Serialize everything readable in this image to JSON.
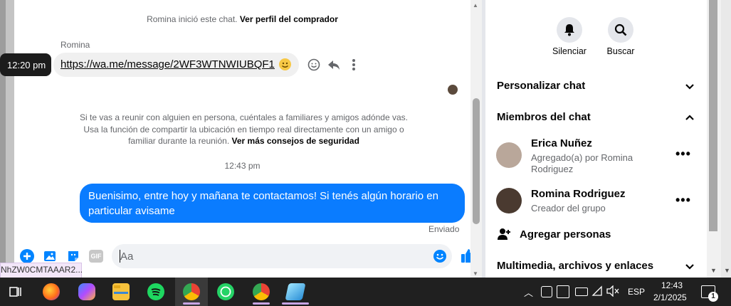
{
  "chat": {
    "system_started": "Romina inició este chat.",
    "system_link": "Ver perfil del comprador",
    "sender_name": "Romina",
    "time_tooltip": "12:20 pm",
    "incoming_message": "https://wa.me/message/2WF3WTNWIUBQF1",
    "safety_text": "Si te vas a reunir con alguien en persona, cuéntales a familiares y amigos adónde vas. Usa la función de compartir la ubicación en tiempo real directamente con un amigo o familiar durante la reunión.",
    "safety_link": "Ver más consejos de seguridad",
    "timestamp": "12:43 pm",
    "outgoing_message": "Buenisimo, entre hoy y mañana te contactamos! Si tenés algún horario en particular avisame",
    "status": "Enviado",
    "composer_placeholder": "Aa",
    "url_tooltip": "NhZW0CMTAAAR2..."
  },
  "panel": {
    "mute_label": "Silenciar",
    "search_label": "Buscar",
    "customize_label": "Personalizar chat",
    "members_label": "Miembros del chat",
    "members": [
      {
        "name": "Erica Nuñez",
        "sub": "Agregado(a) por Romina Rodriguez"
      },
      {
        "name": "Romina Rodriguez",
        "sub": "Creador del grupo"
      }
    ],
    "add_people_label": "Agregar personas",
    "media_label": "Multimedia, archivos y enlaces"
  },
  "taskbar": {
    "language": "ESP",
    "time": "12:43",
    "date": "2/1/2025",
    "notification_count": "1"
  },
  "colors": {
    "accent": "#0084ff",
    "outgoing_bubble": "#0a7cff",
    "incoming_bubble": "#f0f0f0",
    "taskbar": "#202020"
  }
}
